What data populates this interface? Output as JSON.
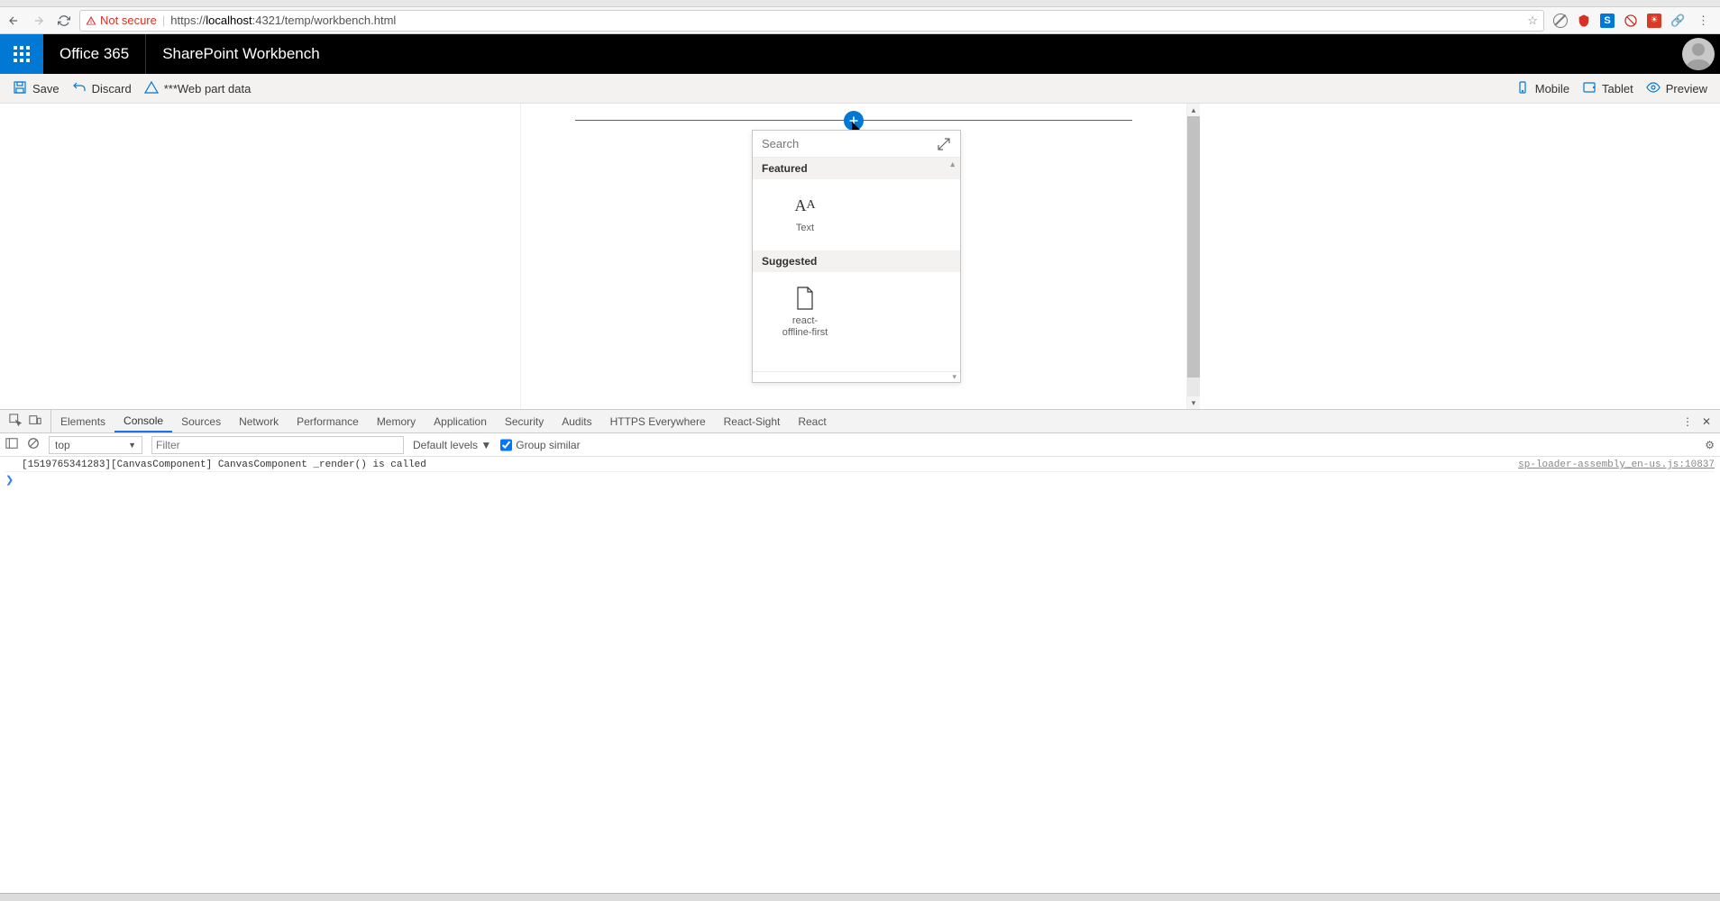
{
  "browser": {
    "not_secure": "Not secure",
    "url_prefix": "https://",
    "url_host": "localhost",
    "url_rest": ":4321/temp/workbench.html"
  },
  "suite": {
    "brand": "Office 365",
    "app": "SharePoint Workbench"
  },
  "commands": {
    "save": "Save",
    "discard": "Discard",
    "webpartdata": "***Web part data",
    "mobile": "Mobile",
    "tablet": "Tablet",
    "preview": "Preview"
  },
  "toolbox": {
    "search_placeholder": "Search",
    "featured_head": "Featured",
    "suggested_head": "Suggested",
    "items": {
      "text": "Text",
      "react_offline": "react-\noffline-first"
    }
  },
  "devtools": {
    "tabs": [
      "Elements",
      "Console",
      "Sources",
      "Network",
      "Performance",
      "Memory",
      "Application",
      "Security",
      "Audits",
      "HTTPS Everywhere",
      "React-Sight",
      "React"
    ],
    "active_tab_index": 1,
    "context": "top",
    "filter_placeholder": "Filter",
    "levels": "Default levels ▼",
    "group_similar": "Group similar",
    "log_msg": "[1519765341283][CanvasComponent] CanvasComponent _render() is called",
    "log_src": "sp-loader-assembly_en-us.js:10837"
  }
}
